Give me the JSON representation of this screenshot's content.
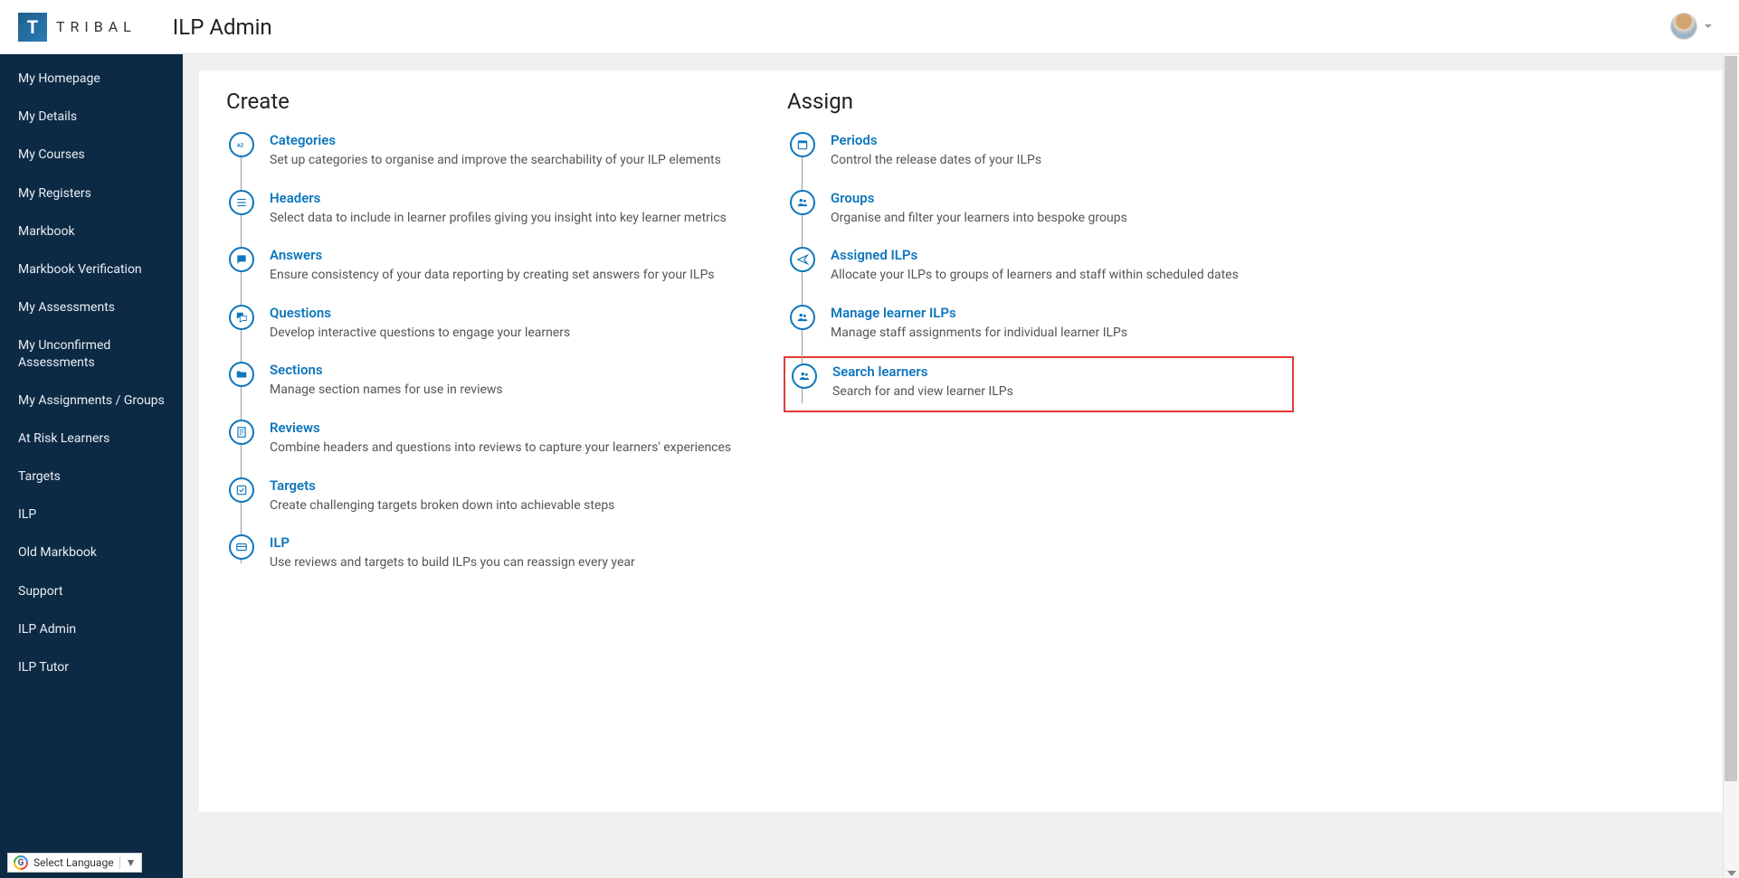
{
  "header": {
    "logo_letter": "T",
    "logo_text": "TRIBAL",
    "page_title": "ILP Admin"
  },
  "sidebar": {
    "items": [
      {
        "label": "My Homepage"
      },
      {
        "label": "My Details"
      },
      {
        "label": "My Courses"
      },
      {
        "label": "My Registers"
      },
      {
        "label": "Markbook"
      },
      {
        "label": "Markbook Verification"
      },
      {
        "label": "My Assessments"
      },
      {
        "label": "My Unconfirmed Assessments"
      },
      {
        "label": "My Assignments / Groups"
      },
      {
        "label": "At Risk Learners"
      },
      {
        "label": "Targets"
      },
      {
        "label": "ILP"
      },
      {
        "label": "Old Markbook"
      },
      {
        "label": "Support"
      },
      {
        "label": "ILP Admin"
      },
      {
        "label": "ILP Tutor"
      }
    ]
  },
  "columns": {
    "create": {
      "title": "Create",
      "items": [
        {
          "title": "Categories",
          "desc": "Set up categories to organise and improve the searchability of your ILP elements",
          "icon": "az"
        },
        {
          "title": "Headers",
          "desc": "Select data to include in learner profiles giving you insight into key learner metrics",
          "icon": "list"
        },
        {
          "title": "Answers",
          "desc": "Ensure consistency of your data reporting by creating set answers for your ILPs",
          "icon": "chat"
        },
        {
          "title": "Questions",
          "desc": "Develop interactive questions to engage your learners",
          "icon": "qa"
        },
        {
          "title": "Sections",
          "desc": "Manage section names for use in reviews",
          "icon": "folder"
        },
        {
          "title": "Reviews",
          "desc": "Combine headers and questions into reviews to capture your learners' experiences",
          "icon": "doc"
        },
        {
          "title": "Targets",
          "desc": "Create challenging targets broken down into achievable steps",
          "icon": "check"
        },
        {
          "title": "ILP",
          "desc": "Use reviews and targets to build ILPs you can reassign every year",
          "icon": "card"
        }
      ]
    },
    "assign": {
      "title": "Assign",
      "items": [
        {
          "title": "Periods",
          "desc": "Control the release dates of your ILPs",
          "icon": "calendar"
        },
        {
          "title": "Groups",
          "desc": "Organise and filter your learners into bespoke groups",
          "icon": "people"
        },
        {
          "title": "Assigned ILPs",
          "desc": "Allocate your ILPs to groups of learners and staff within scheduled dates",
          "icon": "send"
        },
        {
          "title": "Manage learner ILPs",
          "desc": "Manage staff assignments for individual learner ILPs",
          "icon": "people"
        },
        {
          "title": "Search learners",
          "desc": "Search for and view learner ILPs",
          "icon": "people",
          "highlighted": true
        }
      ]
    }
  },
  "footer": {
    "lang_label": "Select Language",
    "lang_caret": "▼"
  }
}
